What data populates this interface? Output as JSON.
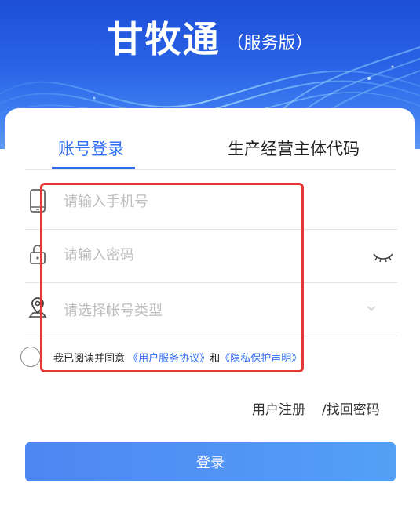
{
  "app": {
    "title": "甘牧通",
    "subtitle": "（服务版）"
  },
  "tabs": [
    {
      "label": "账号登录",
      "active": true
    },
    {
      "label": "生产经营主体代码",
      "active": false
    }
  ],
  "form": {
    "phone_placeholder": "请输入手机号",
    "password_placeholder": "请输入密码",
    "account_type_placeholder": "请选择帐号类型"
  },
  "agreement": {
    "prefix": "我已阅读并同意",
    "user_agreement": "《用户服务协议》",
    "conjunction": "和",
    "privacy": "《隐私保护声明》",
    "checked": false
  },
  "links": {
    "register": "用户注册",
    "forgot": "/找回密码"
  },
  "login_button": "登录",
  "colors": {
    "accent": "#2f6cf0",
    "highlight_border": "#e53935",
    "hero_blue": "#1d4fd8"
  },
  "icons": {
    "phone": "phone-icon",
    "lock": "lock-icon",
    "account": "map-pin-user-icon",
    "eye": "eye-closed-icon",
    "chevron": "chevron-down-icon"
  }
}
